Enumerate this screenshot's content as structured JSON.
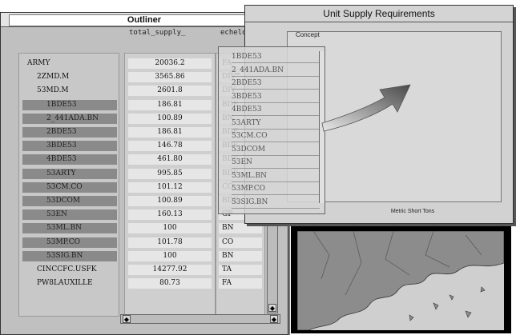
{
  "outliner": {
    "title": "Outliner",
    "col_supply": "total_supply_",
    "col_echelon": "echelon",
    "rows": [
      {
        "name": "ARMY",
        "supply": "20036.2",
        "echelon": "FA",
        "level": 0,
        "selected": false
      },
      {
        "name": "2ZMD.M",
        "supply": "3565.86",
        "echelon": "DIV",
        "level": 1,
        "selected": false
      },
      {
        "name": "53MD.M",
        "supply": "2601.8",
        "echelon": "DIV",
        "level": 1,
        "selected": false
      },
      {
        "name": "1BDE53",
        "supply": "186.81",
        "echelon": "BDE",
        "level": 2,
        "selected": true
      },
      {
        "name": "2_441ADA.BN",
        "supply": "100.89",
        "echelon": "BN",
        "level": 2,
        "selected": true
      },
      {
        "name": "2BDE53",
        "supply": "186.81",
        "echelon": "BDE",
        "level": 2,
        "selected": true
      },
      {
        "name": "3BDE53",
        "supply": "146.78",
        "echelon": "BDE",
        "level": 2,
        "selected": true
      },
      {
        "name": "4BDE53",
        "supply": "461.80",
        "echelon": "BDE",
        "level": 2,
        "selected": true
      },
      {
        "name": "53ARTY",
        "supply": "995.85",
        "echelon": "BDE",
        "level": 2,
        "selected": true
      },
      {
        "name": "53CM.CO",
        "supply": "101.12",
        "echelon": "CO",
        "level": 2,
        "selected": true
      },
      {
        "name": "53DCOM",
        "supply": "100.89",
        "echelon": "BDE",
        "level": 2,
        "selected": true
      },
      {
        "name": "53EN",
        "supply": "160.13",
        "echelon": "GP",
        "level": 2,
        "selected": true
      },
      {
        "name": "53ML.BN",
        "supply": "100",
        "echelon": "BN",
        "level": 2,
        "selected": true
      },
      {
        "name": "53MP.CO",
        "supply": "101.78",
        "echelon": "CO",
        "level": 2,
        "selected": true
      },
      {
        "name": "53SIG.BN",
        "supply": "100",
        "echelon": "BN",
        "level": 2,
        "selected": true
      },
      {
        "name": "CINCCFC.USFK",
        "supply": "14277.92",
        "echelon": "TA",
        "level": 1,
        "selected": false
      },
      {
        "name": "PW8LAUXILLE",
        "supply": "80.73",
        "echelon": "FA",
        "level": 1,
        "selected": false
      }
    ]
  },
  "unit_supply": {
    "title": "Unit Supply Requirements",
    "concept_label": "Concept",
    "footer_label": "Metric Short Tons"
  },
  "dragged_items": [
    "1BDE53",
    "2_441ADA.BN",
    "2BDE53",
    "3BDE53",
    "4BDE53",
    "53ARTY",
    "53CM.CO",
    "53DCOM",
    "53EN",
    "53ML.BN",
    "53MP.CO",
    "53SIG.BN"
  ],
  "colors": {
    "selected_row": "#8a8a8a",
    "arrow": "#6f6f6f"
  }
}
